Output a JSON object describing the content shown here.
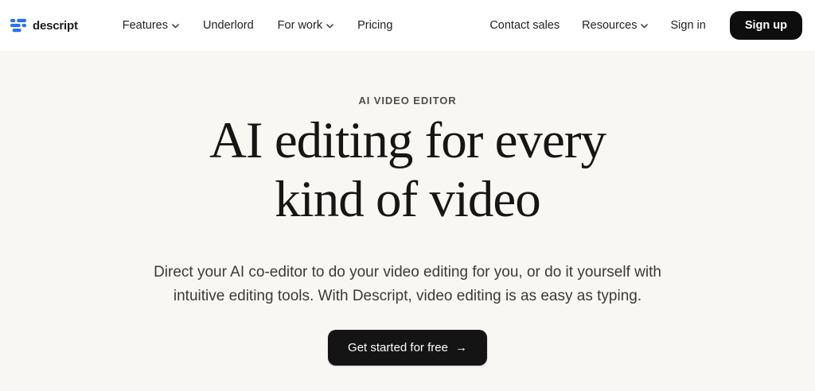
{
  "brand": {
    "name": "descript",
    "logo_color": "#2b6ff2"
  },
  "nav": {
    "left_items": [
      {
        "label": "Features",
        "has_dropdown": true
      },
      {
        "label": "Underlord",
        "has_dropdown": false
      },
      {
        "label": "For work",
        "has_dropdown": true
      },
      {
        "label": "Pricing",
        "has_dropdown": false
      }
    ],
    "right_items": [
      {
        "label": "Contact sales",
        "has_dropdown": false
      },
      {
        "label": "Resources",
        "has_dropdown": true
      },
      {
        "label": "Sign in",
        "has_dropdown": false
      }
    ],
    "signup_label": "Sign up"
  },
  "hero": {
    "eyebrow": "AI VIDEO EDITOR",
    "heading_line1": "AI editing for every",
    "heading_line2": "kind of video",
    "subtext": "Direct your AI co-editor to do your video editing for you, or do it yourself with intuitive editing tools. With Descript, video editing is as easy as typing.",
    "cta_label": "Get started for free",
    "cta_arrow": "→"
  },
  "colors": {
    "nav_background": "#ffffff",
    "hero_background": "#f9f7f3",
    "button_background": "#121212",
    "button_text": "#ffffff",
    "heading_text": "#171615",
    "logo_blue": "#2b6ff2"
  }
}
